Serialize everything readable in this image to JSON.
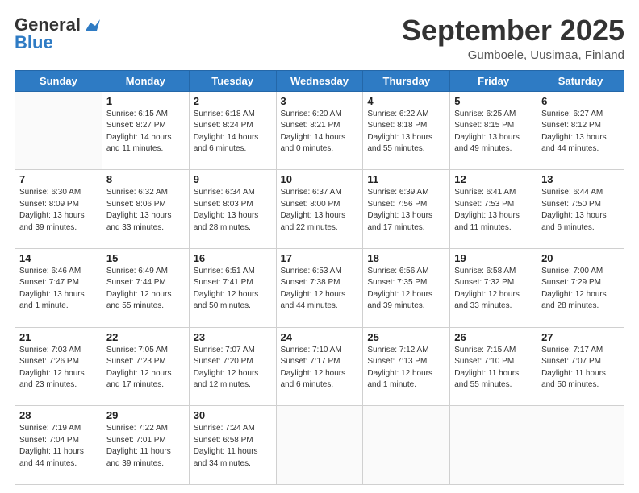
{
  "logo": {
    "general": "General",
    "blue": "Blue"
  },
  "header": {
    "month": "September 2025",
    "location": "Gumboele, Uusimaa, Finland"
  },
  "weekdays": [
    "Sunday",
    "Monday",
    "Tuesday",
    "Wednesday",
    "Thursday",
    "Friday",
    "Saturday"
  ],
  "weeks": [
    [
      {
        "day": "",
        "info": ""
      },
      {
        "day": "1",
        "info": "Sunrise: 6:15 AM\nSunset: 8:27 PM\nDaylight: 14 hours\nand 11 minutes."
      },
      {
        "day": "2",
        "info": "Sunrise: 6:18 AM\nSunset: 8:24 PM\nDaylight: 14 hours\nand 6 minutes."
      },
      {
        "day": "3",
        "info": "Sunrise: 6:20 AM\nSunset: 8:21 PM\nDaylight: 14 hours\nand 0 minutes."
      },
      {
        "day": "4",
        "info": "Sunrise: 6:22 AM\nSunset: 8:18 PM\nDaylight: 13 hours\nand 55 minutes."
      },
      {
        "day": "5",
        "info": "Sunrise: 6:25 AM\nSunset: 8:15 PM\nDaylight: 13 hours\nand 49 minutes."
      },
      {
        "day": "6",
        "info": "Sunrise: 6:27 AM\nSunset: 8:12 PM\nDaylight: 13 hours\nand 44 minutes."
      }
    ],
    [
      {
        "day": "7",
        "info": "Sunrise: 6:30 AM\nSunset: 8:09 PM\nDaylight: 13 hours\nand 39 minutes."
      },
      {
        "day": "8",
        "info": "Sunrise: 6:32 AM\nSunset: 8:06 PM\nDaylight: 13 hours\nand 33 minutes."
      },
      {
        "day": "9",
        "info": "Sunrise: 6:34 AM\nSunset: 8:03 PM\nDaylight: 13 hours\nand 28 minutes."
      },
      {
        "day": "10",
        "info": "Sunrise: 6:37 AM\nSunset: 8:00 PM\nDaylight: 13 hours\nand 22 minutes."
      },
      {
        "day": "11",
        "info": "Sunrise: 6:39 AM\nSunset: 7:56 PM\nDaylight: 13 hours\nand 17 minutes."
      },
      {
        "day": "12",
        "info": "Sunrise: 6:41 AM\nSunset: 7:53 PM\nDaylight: 13 hours\nand 11 minutes."
      },
      {
        "day": "13",
        "info": "Sunrise: 6:44 AM\nSunset: 7:50 PM\nDaylight: 13 hours\nand 6 minutes."
      }
    ],
    [
      {
        "day": "14",
        "info": "Sunrise: 6:46 AM\nSunset: 7:47 PM\nDaylight: 13 hours\nand 1 minute."
      },
      {
        "day": "15",
        "info": "Sunrise: 6:49 AM\nSunset: 7:44 PM\nDaylight: 12 hours\nand 55 minutes."
      },
      {
        "day": "16",
        "info": "Sunrise: 6:51 AM\nSunset: 7:41 PM\nDaylight: 12 hours\nand 50 minutes."
      },
      {
        "day": "17",
        "info": "Sunrise: 6:53 AM\nSunset: 7:38 PM\nDaylight: 12 hours\nand 44 minutes."
      },
      {
        "day": "18",
        "info": "Sunrise: 6:56 AM\nSunset: 7:35 PM\nDaylight: 12 hours\nand 39 minutes."
      },
      {
        "day": "19",
        "info": "Sunrise: 6:58 AM\nSunset: 7:32 PM\nDaylight: 12 hours\nand 33 minutes."
      },
      {
        "day": "20",
        "info": "Sunrise: 7:00 AM\nSunset: 7:29 PM\nDaylight: 12 hours\nand 28 minutes."
      }
    ],
    [
      {
        "day": "21",
        "info": "Sunrise: 7:03 AM\nSunset: 7:26 PM\nDaylight: 12 hours\nand 23 minutes."
      },
      {
        "day": "22",
        "info": "Sunrise: 7:05 AM\nSunset: 7:23 PM\nDaylight: 12 hours\nand 17 minutes."
      },
      {
        "day": "23",
        "info": "Sunrise: 7:07 AM\nSunset: 7:20 PM\nDaylight: 12 hours\nand 12 minutes."
      },
      {
        "day": "24",
        "info": "Sunrise: 7:10 AM\nSunset: 7:17 PM\nDaylight: 12 hours\nand 6 minutes."
      },
      {
        "day": "25",
        "info": "Sunrise: 7:12 AM\nSunset: 7:13 PM\nDaylight: 12 hours\nand 1 minute."
      },
      {
        "day": "26",
        "info": "Sunrise: 7:15 AM\nSunset: 7:10 PM\nDaylight: 11 hours\nand 55 minutes."
      },
      {
        "day": "27",
        "info": "Sunrise: 7:17 AM\nSunset: 7:07 PM\nDaylight: 11 hours\nand 50 minutes."
      }
    ],
    [
      {
        "day": "28",
        "info": "Sunrise: 7:19 AM\nSunset: 7:04 PM\nDaylight: 11 hours\nand 44 minutes."
      },
      {
        "day": "29",
        "info": "Sunrise: 7:22 AM\nSunset: 7:01 PM\nDaylight: 11 hours\nand 39 minutes."
      },
      {
        "day": "30",
        "info": "Sunrise: 7:24 AM\nSunset: 6:58 PM\nDaylight: 11 hours\nand 34 minutes."
      },
      {
        "day": "",
        "info": ""
      },
      {
        "day": "",
        "info": ""
      },
      {
        "day": "",
        "info": ""
      },
      {
        "day": "",
        "info": ""
      }
    ]
  ]
}
